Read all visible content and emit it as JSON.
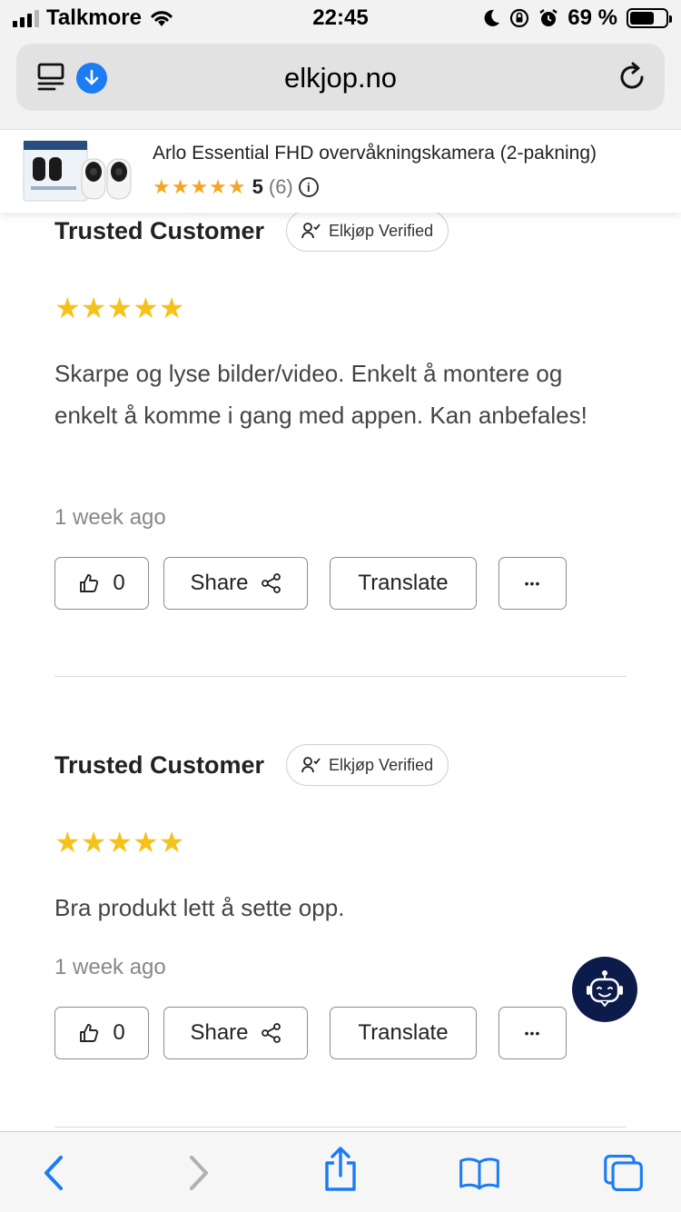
{
  "status_bar": {
    "carrier": "Talkmore",
    "time": "22:45",
    "battery_percent": "69 %",
    "battery_level": 0.69
  },
  "browser": {
    "url": "elkjop.no",
    "icons": [
      "reader-icon",
      "download-icon",
      "reload-icon"
    ]
  },
  "product": {
    "title": "Arlo Essential FHD overvåkningskamera (2-pakning)",
    "stars": "★★★★★",
    "rating": "5",
    "review_count": "(6)",
    "info_glyph": "i"
  },
  "reviews": [
    {
      "name": "Trusted Customer",
      "badge": "Elkjøp Verified",
      "stars": "★★★★★",
      "rating": 5,
      "text": "Skarpe og lyse bilder/video. Enkelt å montere og enkelt å komme i gang med appen. Kan anbefales!",
      "date": "1 week ago",
      "likes": "0",
      "share_label": "Share",
      "translate_label": "Translate",
      "more_label": "•••"
    },
    {
      "name": "Trusted Customer",
      "badge": "Elkjøp Verified",
      "stars": "★★★★★",
      "rating": 5,
      "text": "Bra produkt lett å sette opp.",
      "date": "1 week ago",
      "likes": "0",
      "share_label": "Share",
      "translate_label": "Translate",
      "more_label": "•••"
    }
  ],
  "colors": {
    "star_yellow": "#f5c21a",
    "safari_blue": "#1b7cf3",
    "chatbot_navy": "#0d1b4b"
  }
}
